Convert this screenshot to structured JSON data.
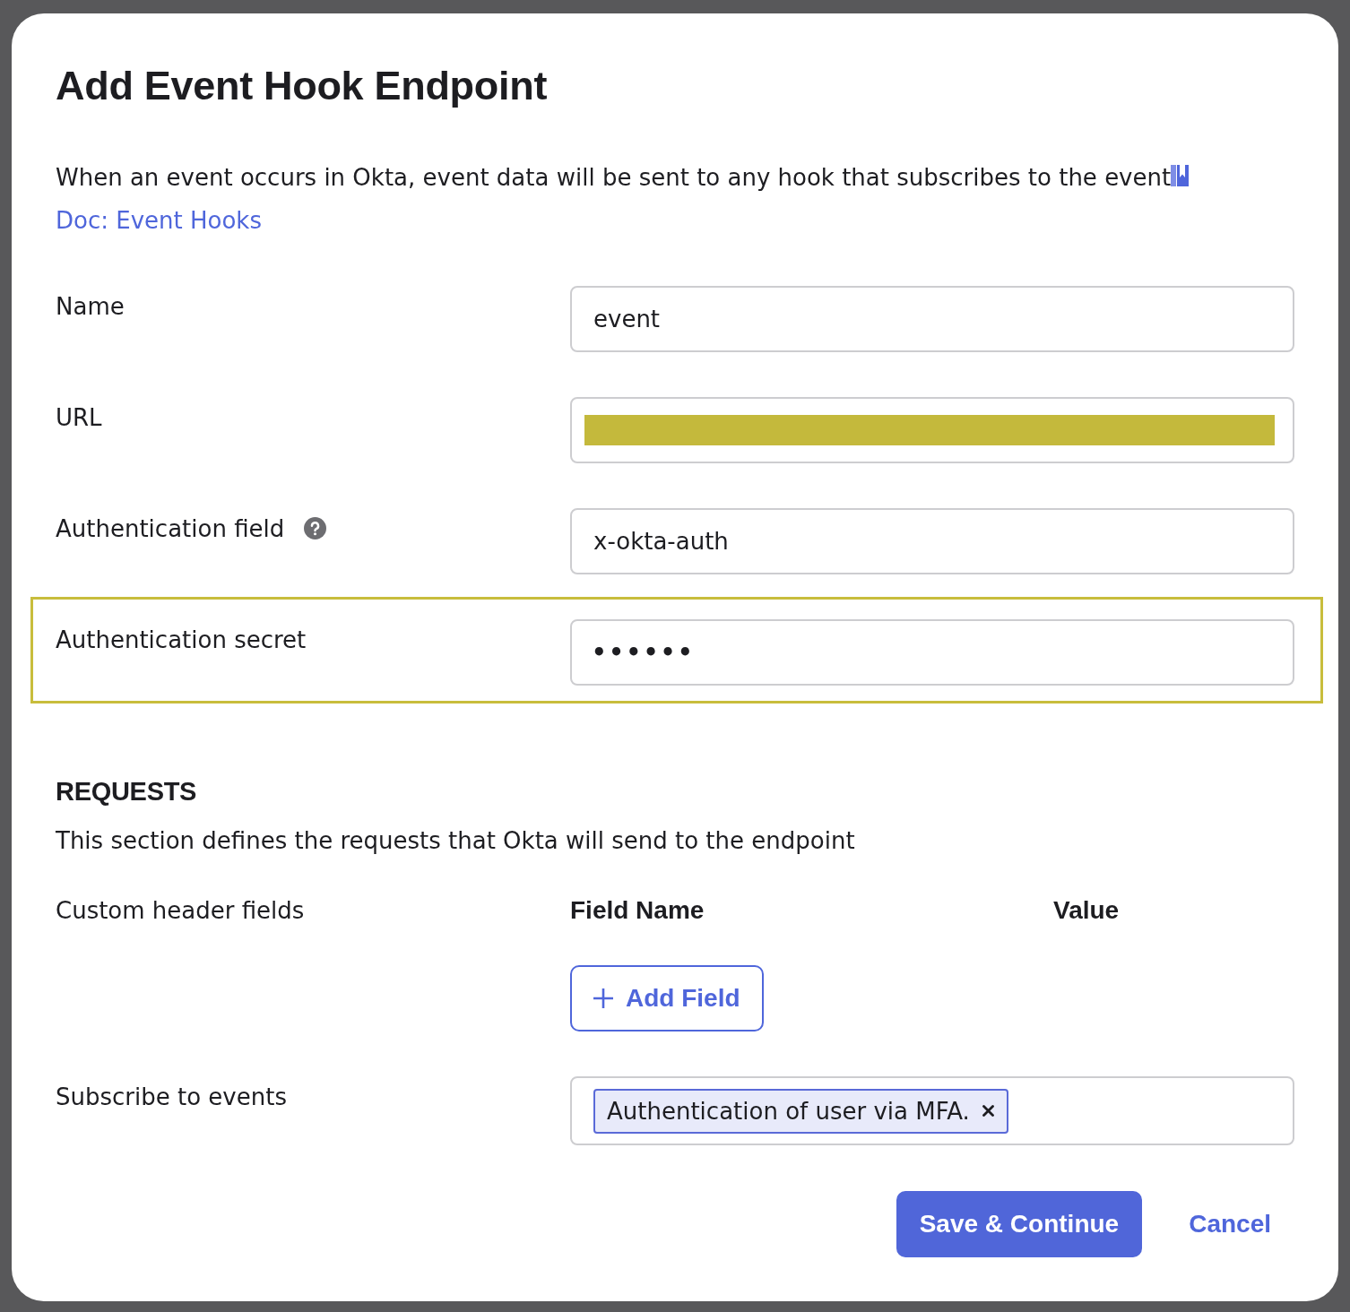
{
  "dialog": {
    "title": "Add Event Hook Endpoint",
    "description": {
      "text": "When an event occurs in Okta, event data will be sent to any hook that subscribes to the event",
      "link": "Doc: Event Hooks"
    },
    "fields": [
      {
        "label": "Name",
        "kind": "text",
        "value": "event",
        "help": false,
        "redacted": false,
        "highlighted": false
      },
      {
        "label": "URL",
        "kind": "text",
        "help": false,
        "redacted": true,
        "highlighted": false
      },
      {
        "label": "Authentication field",
        "kind": "text",
        "value": "x-okta-auth",
        "help": true,
        "redacted": false,
        "highlighted": false
      },
      {
        "label": "Authentication secret",
        "kind": "password",
        "value": "••••••",
        "help": false,
        "redacted": false,
        "highlighted": true
      }
    ],
    "requests": {
      "heading": "REQUESTS",
      "description": "This section defines the requests that Okta will send to the endpoint",
      "custom_headers": {
        "label": "Custom header fields",
        "columns": [
          "Field Name",
          "Value"
        ],
        "add_button": "Add Field"
      },
      "subscribe": {
        "label": "Subscribe to events",
        "tags": [
          "Authentication of user via MFA."
        ]
      }
    },
    "buttons": [
      {
        "label": "Save & Continue",
        "kind": "primary"
      },
      {
        "label": "Cancel",
        "kind": "link"
      }
    ]
  }
}
